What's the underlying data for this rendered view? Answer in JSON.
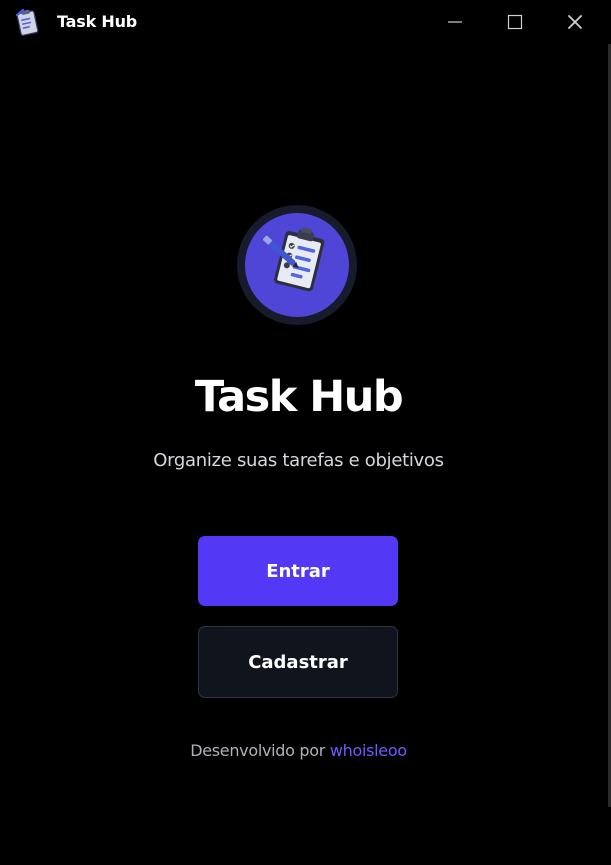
{
  "window": {
    "title": "Task Hub",
    "controls": {
      "minimize": "—",
      "maximize": "☐",
      "close": "✕"
    }
  },
  "hero": {
    "title": "Task Hub",
    "subtitle": "Organize suas tarefas e objetivos",
    "logo_icon": "clipboard-checklist-icon"
  },
  "actions": {
    "login_label": "Entrar",
    "register_label": "Cadastrar"
  },
  "footer": {
    "prefix": "Desenvolvido por",
    "author": "whoisleoo"
  },
  "colors": {
    "background": "#000000",
    "primary": "#5339f5",
    "secondary_bg": "#0f141d",
    "link": "#6b5cff",
    "logo_ring": "#1a1e2e",
    "logo_fill": "#4f46d8"
  }
}
